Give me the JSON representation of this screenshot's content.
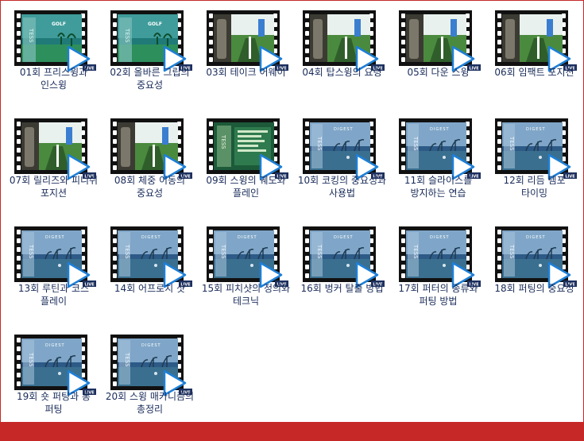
{
  "badge": "LIVE",
  "colors": {
    "accent": "#1e7fd6",
    "border": "#c62828",
    "label": "#1a2c5a"
  },
  "items": [
    {
      "label": "01회 프리스윙과 인스윙",
      "thumb": "golf-green",
      "title": "GOLF"
    },
    {
      "label": "02회 올바른 그립의 중요성",
      "thumb": "golf-green",
      "title": "GOLF"
    },
    {
      "label": "03회 테이크 어웨이",
      "thumb": "player-closeup",
      "title": ""
    },
    {
      "label": "04회 탑스윙의 요령",
      "thumb": "player-closeup",
      "title": ""
    },
    {
      "label": "05회 다운 스윙",
      "thumb": "player-closeup",
      "title": ""
    },
    {
      "label": "06회 임팩트 포지션",
      "thumb": "player-closeup",
      "title": ""
    },
    {
      "label": "07회 릴리즈와 피니쉬 포지션",
      "thumb": "player-closeup",
      "title": ""
    },
    {
      "label": "08회 체중 이동의 중요성",
      "thumb": "player-closeup",
      "title": ""
    },
    {
      "label": "09회 스윙의 궤도와 플레인",
      "thumb": "golf-dark",
      "title": ""
    },
    {
      "label": "10회 코킹의 중요성과 사용법",
      "thumb": "digest-blue",
      "title": "DIGEST"
    },
    {
      "label": "11회 슬라이스를 방지하는 연습",
      "thumb": "digest-blue",
      "title": "DIGEST"
    },
    {
      "label": "12회 리듬 템포 타이밍",
      "thumb": "digest-blue",
      "title": "DIGEST"
    },
    {
      "label": "13회 루틴과 코스 플레이",
      "thumb": "digest-blue",
      "title": "DIGEST"
    },
    {
      "label": "14회 어프로치 샷",
      "thumb": "digest-blue",
      "title": "DIGEST"
    },
    {
      "label": "15회 피치샷의 정의와 테크닉",
      "thumb": "digest-blue",
      "title": "DIGEST"
    },
    {
      "label": "16회 벙커 탈출 방법",
      "thumb": "digest-blue",
      "title": "DIGEST"
    },
    {
      "label": "17회 퍼터의 종류와 퍼팅 방법",
      "thumb": "digest-blue",
      "title": "DIGEST"
    },
    {
      "label": "18회 퍼팅의 중요성",
      "thumb": "digest-blue",
      "title": "DIGEST"
    },
    {
      "label": "19회 숏 퍼팅과 롱 퍼팅",
      "thumb": "digest-blue",
      "title": "DIGEST"
    },
    {
      "label": "20회 스윙 매카니즘의 총정리",
      "thumb": "digest-blue",
      "title": "DIGEST"
    }
  ]
}
